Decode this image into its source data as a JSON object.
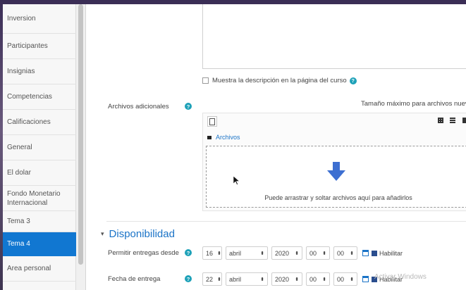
{
  "sidebar": {
    "items": [
      {
        "label": "Inversion",
        "active": false
      },
      {
        "label": "Participantes",
        "active": false
      },
      {
        "label": "Insignias",
        "active": false
      },
      {
        "label": "Competencias",
        "active": false
      },
      {
        "label": "Calificaciones",
        "active": false
      },
      {
        "label": "General",
        "active": false
      },
      {
        "label": "El dolar",
        "active": false
      },
      {
        "label": "Fondo Monetario Internacional",
        "active": false
      },
      {
        "label": "Tema 3",
        "active": false
      },
      {
        "label": "Tema 4",
        "active": true
      },
      {
        "label": "Area personal",
        "active": false
      }
    ]
  },
  "form": {
    "show_description_label": "Muestra la descripción en la página del curso",
    "additional_files_label": "Archivos adicionales",
    "max_size_text": "Tamaño máximo para archivos nuevos: Sin límite",
    "path_folder": "Archivos",
    "drop_text": "Puede arrastrar y soltar archivos aquí para añadirlos"
  },
  "availability": {
    "section_title": "Disponibilidad",
    "allow_from": {
      "label": "Permitir entregas desde",
      "day": "16",
      "month": "abril",
      "year": "2020",
      "hour": "00",
      "minute": "00",
      "enable_label": "Habilitar"
    },
    "due_date": {
      "label": "Fecha de entrega",
      "day": "22",
      "month": "abril",
      "year": "2020",
      "hour": "00",
      "minute": "00",
      "enable_label": "Habilitar"
    }
  },
  "watermark": "Activar Windows",
  "colors": {
    "accent": "#1a73c7",
    "active_nav": "#1177d1",
    "help": "#1da1b8",
    "upload_arrow": "#3d6fd1"
  },
  "icons": [
    "help-icon",
    "file-icon",
    "folder-icon",
    "upload-arrow-icon",
    "calendar-icon",
    "mouse-cursor-icon",
    "grid-view-icon",
    "list-view-icon",
    "tree-view-icon",
    "chevron-down-icon"
  ]
}
